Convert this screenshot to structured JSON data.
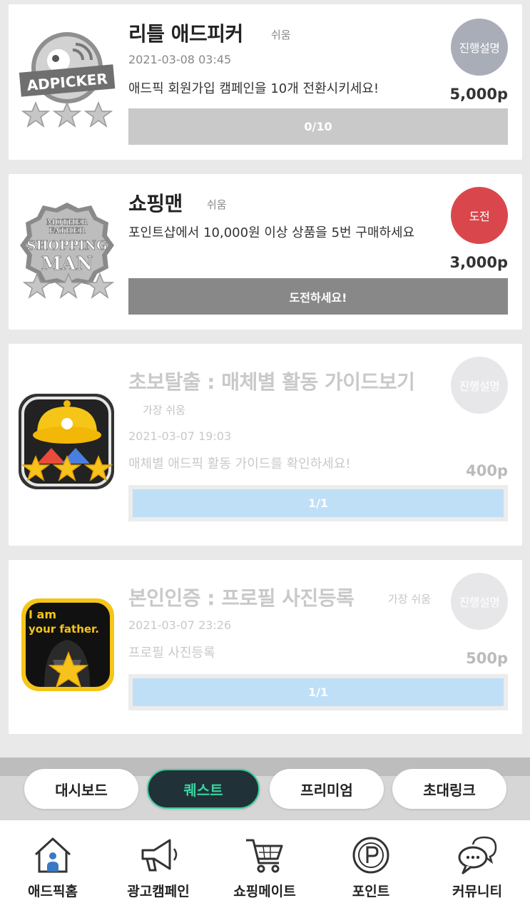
{
  "quests": [
    {
      "title": "리틀 애드피커",
      "difficulty": "쉬움",
      "date": "2021-03-08 03:45",
      "description": "애드픽 회원가입 캠페인을 10개 전환시키세요!",
      "status": "진행설명",
      "points": "5,000p",
      "progress_label": "0/10",
      "badge_text": "ADPICKER"
    },
    {
      "title": "쇼핑맨",
      "difficulty": "쉬움",
      "date": "",
      "description": "포인트샵에서 10,000원 이상 상품을 5번 구매하세요",
      "status": "도전",
      "points": "3,000p",
      "progress_label": "도전하세요!",
      "badge_text": [
        "MOTHER",
        "FATHER",
        "SHOPPING",
        "MAN"
      ]
    },
    {
      "title": "초보탈출 : 매체별 활동 가이드보기",
      "difficulty": "가장 쉬움",
      "date": "2021-03-07 19:03",
      "description": "매체별 애드픽 활동 가이드를 확인하세요!",
      "status": "진행설명",
      "points": "400p",
      "progress_label": "1/1",
      "progress_fraction": 1.0
    },
    {
      "title": "본인인증 : 프로필 사진등록",
      "difficulty": "가장 쉬움",
      "date": "2021-03-07 23:26",
      "description": "프로필 사진등록",
      "status": "진행설명",
      "points": "500p",
      "progress_label": "1/1",
      "progress_fraction": 1.0,
      "badge_text": [
        "I am",
        "your father."
      ]
    }
  ],
  "tabs": {
    "items": [
      "대시보드",
      "퀘스트",
      "프리미엄",
      "초대링크"
    ],
    "active": "퀘스트"
  },
  "bottom_nav": [
    {
      "label": "애드픽홈",
      "icon": "home-icon"
    },
    {
      "label": "광고캠페인",
      "icon": "megaphone-icon"
    },
    {
      "label": "쇼핑메이트",
      "icon": "shopping-cart-icon"
    },
    {
      "label": "포인트",
      "icon": "point-coin-icon"
    },
    {
      "label": "커뮤니티",
      "icon": "chat-bubbles-icon"
    }
  ],
  "colors": {
    "status_info": "#a9adb8",
    "status_challenge": "#d9474d",
    "progress_gray": "#c9c9c9",
    "challenge_bar": "#888888",
    "complete_bar": "#bfdff7",
    "tab_active_bg": "#203237",
    "tab_active_text": "#38d39f"
  }
}
